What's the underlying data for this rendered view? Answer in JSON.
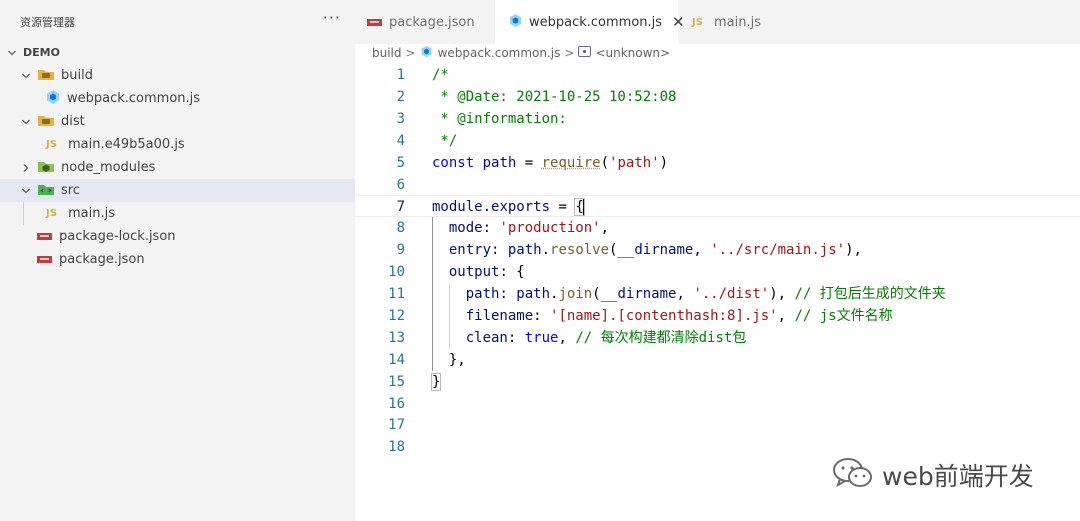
{
  "explorer": {
    "title": "资源管理器",
    "more_glyph": "···",
    "root": "DEMO",
    "items": [
      {
        "label": "build",
        "kind": "folder",
        "expanded": true
      },
      {
        "label": "webpack.common.js",
        "kind": "webpack-file"
      },
      {
        "label": "dist",
        "kind": "folder",
        "expanded": true
      },
      {
        "label": "main.e49b5a00.js",
        "kind": "js-file",
        "badge": "JS"
      },
      {
        "label": "node_modules",
        "kind": "folder",
        "expanded": false
      },
      {
        "label": "src",
        "kind": "folder",
        "expanded": true,
        "selected": true
      },
      {
        "label": "main.js",
        "kind": "js-file",
        "badge": "JS"
      },
      {
        "label": "package-lock.json",
        "kind": "npm-file"
      },
      {
        "label": "package.json",
        "kind": "npm-file"
      }
    ]
  },
  "tabs": [
    {
      "label": "package.json",
      "icon": "npm-icon",
      "active": false
    },
    {
      "label": "webpack.common.js",
      "icon": "webpack-icon",
      "active": true,
      "close_glyph": "✕"
    },
    {
      "label": "main.js",
      "icon": "js-icon",
      "badge": "JS",
      "active": false
    }
  ],
  "breadcrumb": {
    "parts": [
      "build",
      "webpack.common.js",
      "<unknown>"
    ],
    "separator": ">"
  },
  "editor": {
    "current_line": 7,
    "lines": [
      {
        "n": "1",
        "tokens": [
          [
            "/*",
            "com"
          ]
        ]
      },
      {
        "n": "2",
        "tokens": [
          [
            " * @Date: 2021-10-25 10:52:08",
            "com"
          ]
        ]
      },
      {
        "n": "3",
        "tokens": [
          [
            " * @information:",
            "com"
          ]
        ]
      },
      {
        "n": "4",
        "tokens": [
          [
            " */",
            "com"
          ]
        ]
      },
      {
        "n": "5",
        "tokens": [
          [
            "const",
            "kw"
          ],
          [
            " ",
            "p"
          ],
          [
            "path",
            "var"
          ],
          [
            " = ",
            "p"
          ],
          [
            "require",
            "fn",
            "squiggle"
          ],
          [
            "(",
            "p"
          ],
          [
            "'path'",
            "str"
          ],
          [
            ")",
            "p"
          ]
        ]
      },
      {
        "n": "6",
        "tokens": []
      },
      {
        "n": "7",
        "tokens": [
          [
            "module",
            "var"
          ],
          [
            ".",
            "p"
          ],
          [
            "exports",
            "var"
          ],
          [
            " = ",
            "p"
          ],
          [
            "{",
            "p",
            "bracket"
          ]
        ]
      },
      {
        "n": "8",
        "tokens": [
          [
            "  ",
            "p"
          ],
          [
            "mode",
            "var"
          ],
          [
            ": ",
            "p"
          ],
          [
            "'production'",
            "str"
          ],
          [
            ",",
            "p"
          ]
        ]
      },
      {
        "n": "9",
        "tokens": [
          [
            "  ",
            "p"
          ],
          [
            "entry",
            "var"
          ],
          [
            ": ",
            "p"
          ],
          [
            "path",
            "var"
          ],
          [
            ".",
            "p"
          ],
          [
            "resolve",
            "fn"
          ],
          [
            "(",
            "p"
          ],
          [
            "__dirname",
            "var"
          ],
          [
            ", ",
            "p"
          ],
          [
            "'../src/main.js'",
            "str"
          ],
          [
            "),",
            "p"
          ]
        ]
      },
      {
        "n": "10",
        "tokens": [
          [
            "  ",
            "p"
          ],
          [
            "output",
            "var"
          ],
          [
            ": {",
            "p"
          ]
        ]
      },
      {
        "n": "11",
        "tokens": [
          [
            "    ",
            "p"
          ],
          [
            "path",
            "var"
          ],
          [
            ": ",
            "p"
          ],
          [
            "path",
            "var"
          ],
          [
            ".",
            "p"
          ],
          [
            "join",
            "fn"
          ],
          [
            "(",
            "p"
          ],
          [
            "__dirname",
            "var"
          ],
          [
            ", ",
            "p"
          ],
          [
            "'../dist'",
            "str"
          ],
          [
            "), ",
            "p"
          ],
          [
            "// 打包后生成的文件夹",
            "com"
          ]
        ]
      },
      {
        "n": "12",
        "tokens": [
          [
            "    ",
            "p"
          ],
          [
            "filename",
            "var"
          ],
          [
            ": ",
            "p"
          ],
          [
            "'[name].[contenthash:8].js'",
            "str"
          ],
          [
            ", ",
            "p"
          ],
          [
            "// js文件名称",
            "com"
          ]
        ]
      },
      {
        "n": "13",
        "tokens": [
          [
            "    ",
            "p"
          ],
          [
            "clean",
            "var"
          ],
          [
            ": ",
            "p"
          ],
          [
            "true",
            "kw"
          ],
          [
            ", ",
            "p"
          ],
          [
            "// 每次构建都清除dist包",
            "com"
          ]
        ]
      },
      {
        "n": "14",
        "tokens": [
          [
            "  ",
            "p"
          ],
          [
            "},",
            "p"
          ]
        ]
      },
      {
        "n": "15",
        "tokens": [
          [
            "}",
            "p",
            "bracket"
          ]
        ]
      },
      {
        "n": "16",
        "tokens": []
      },
      {
        "n": "17",
        "tokens": []
      },
      {
        "n": "18",
        "tokens": []
      }
    ]
  },
  "watermark": {
    "text": "web前端开发",
    "icon": "wechat-icon"
  },
  "colors": {
    "comment": "#008000",
    "keyword": "#0000ff",
    "variable": "#001080",
    "function": "#795e26",
    "string": "#a31515",
    "line_number": "#237893",
    "sidebar_bg": "#f3f3f3",
    "selected_row": "#e4e6f1",
    "npm_red": "#cb3837",
    "js_yellow": "#cbb54a",
    "webpack_blue": "#8ed6fb"
  }
}
